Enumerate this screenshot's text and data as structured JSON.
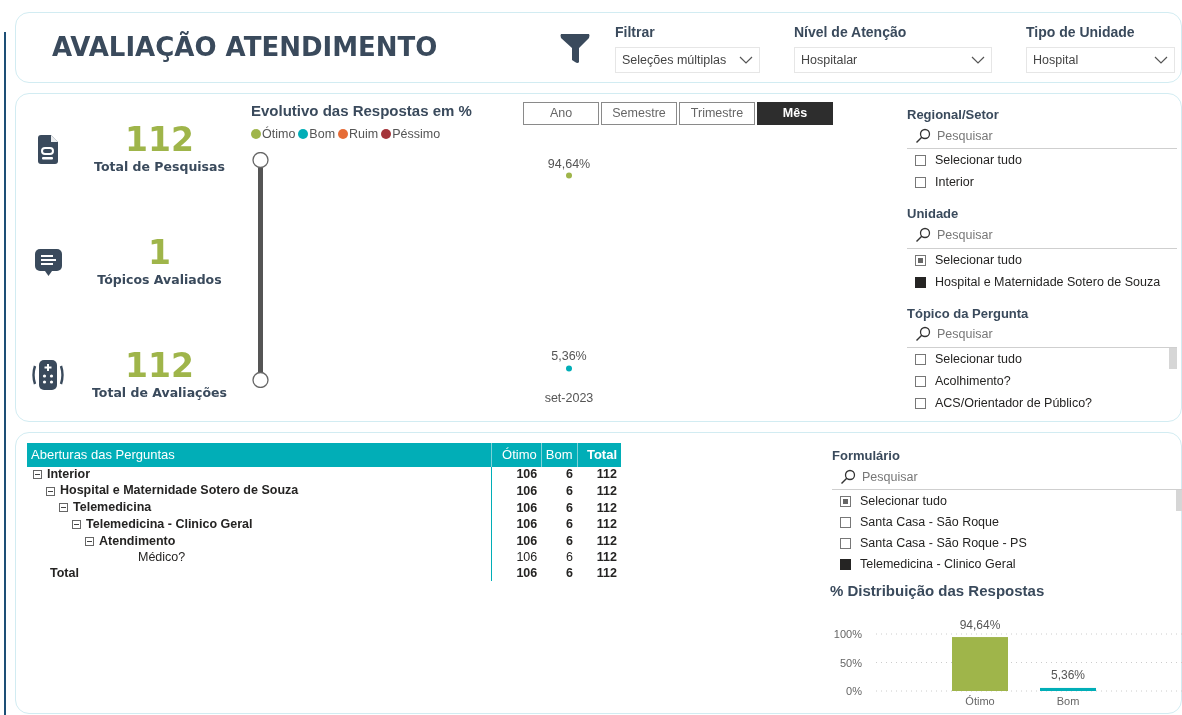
{
  "title": "AVALIAÇÃO ATENDIMENTO",
  "filters": [
    {
      "label": "Filtrar",
      "value": "Seleções múltiplas"
    },
    {
      "label": "Nível de Atenção",
      "value": "Hospitalar"
    },
    {
      "label": "Tipo de Unidade",
      "value": "Hospital"
    }
  ],
  "kpis": [
    {
      "kind": "document",
      "value": "112",
      "label": "Total de Pesquisas"
    },
    {
      "kind": "chat",
      "value": "1",
      "label": "Tópicos Avaliados"
    },
    {
      "kind": "device",
      "value": "112",
      "label": "Total de Avaliações"
    }
  ],
  "trend": {
    "title": "Evolutivo das Respostas em %",
    "legend": [
      {
        "name": "Ótimo",
        "color": "#9fb54a"
      },
      {
        "name": "Bom",
        "color": "#01aeb7"
      },
      {
        "name": "Ruim",
        "color": "#e66c37"
      },
      {
        "name": "Péssimo",
        "color": "#a4343a"
      }
    ],
    "range_slider": {
      "handles": [
        {
          "level": 1
        },
        {
          "level": 0
        }
      ]
    },
    "periods": [
      {
        "label": "Ano",
        "selected": false
      },
      {
        "label": "Semestre",
        "selected": false
      },
      {
        "label": "Trimestre",
        "selected": false
      },
      {
        "label": "Mês",
        "selected": true
      }
    ],
    "points": [
      {
        "label": "94,64%",
        "color": "#9fb54a"
      },
      {
        "label": "5,36%",
        "color": "#01aeb7"
      }
    ],
    "x_label": "set-2023"
  },
  "slicers": [
    {
      "title": "Regional/Setor",
      "placeholder": "Pesquisar",
      "select_all": {
        "label": "Selecionar tudo",
        "partial": false
      },
      "items": [
        {
          "label": "Interior",
          "checked": false
        }
      ]
    },
    {
      "title": "Unidade",
      "placeholder": "Pesquisar",
      "select_all": {
        "label": "Selecionar tudo",
        "partial": true
      },
      "items": [
        {
          "label": "Hospital e Maternidade Sotero de Souza",
          "checked": true
        }
      ]
    },
    {
      "title": "Tópico da Pergunta",
      "placeholder": "Pesquisar",
      "scrollable": true,
      "select_all": {
        "label": "Selecionar tudo",
        "partial": false
      },
      "items": [
        {
          "label": "Acolhimento?",
          "checked": false
        },
        {
          "label": "ACS/Orientador de Público?",
          "checked": false
        }
      ]
    }
  ],
  "table": {
    "columns": [
      "Aberturas das Perguntas",
      "Ótimo",
      "Bom",
      "Total"
    ],
    "rows": [
      {
        "label": "Interior",
        "values": [
          "106",
          "6",
          "112"
        ],
        "expanded": true,
        "children": [
          {
            "label": "Hospital e Maternidade Sotero de Souza",
            "values": [
              "106",
              "6",
              "112"
            ],
            "expanded": true,
            "children": [
              {
                "label": "Telemedicina",
                "values": [
                  "106",
                  "6",
                  "112"
                ],
                "expanded": true,
                "children": [
                  {
                    "label": "Telemedicina - Clinico Geral",
                    "values": [
                      "106",
                      "6",
                      "112"
                    ],
                    "expanded": true,
                    "children": [
                      {
                        "label": "Atendimento",
                        "values": [
                          "106",
                          "6",
                          "112"
                        ],
                        "expanded": true,
                        "children": [
                          {
                            "label": "Médico?",
                            "values": [
                              "106",
                              "6",
                              "112"
                            ]
                          }
                        ]
                      }
                    ]
                  }
                ]
              }
            ]
          }
        ]
      }
    ],
    "total": {
      "label": "Total",
      "values": [
        "106",
        "6",
        "112"
      ]
    }
  },
  "form_slicer": {
    "title": "Formulário",
    "placeholder": "Pesquisar",
    "scrollable": true,
    "select_all": {
      "label": "Selecionar tudo",
      "partial": true
    },
    "items": [
      {
        "label": "Santa Casa - São Roque",
        "checked": false
      },
      {
        "label": "Santa Casa - São Roque - PS",
        "checked": false
      },
      {
        "label": "Telemedicina - Clinico Geral",
        "checked": true
      }
    ]
  },
  "distribution": {
    "chart_data": {
      "type": "bar",
      "title": "% Distribuição das Respostas",
      "categories": [
        "Ótimo",
        "Bom"
      ],
      "stacked": true,
      "series": [
        {
          "color": "#9fb54a",
          "values": [
            94.64,
            null
          ]
        },
        {
          "color": "#01aeb7",
          "values": [
            null,
            5.36
          ]
        }
      ],
      "ylim": [
        0,
        100
      ],
      "yticks": [
        {
          "value": 0,
          "label": "0%"
        },
        {
          "value": 50,
          "label": "50%"
        },
        {
          "value": 100,
          "label": "100%"
        }
      ],
      "value_labels": [
        "94,64%",
        "5,36%"
      ]
    }
  }
}
